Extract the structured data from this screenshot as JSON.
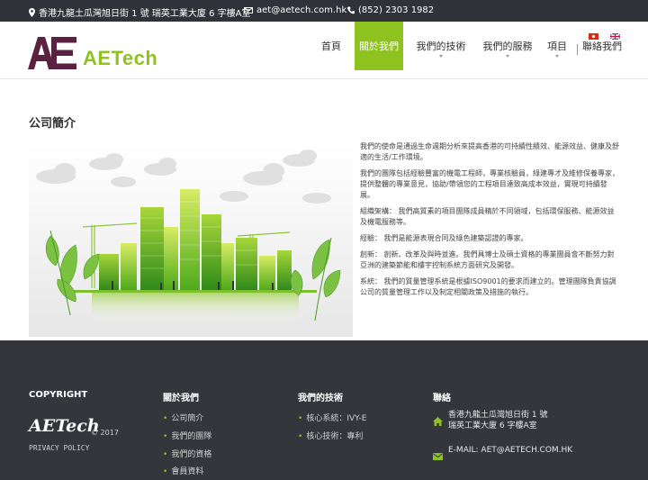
{
  "topbar": {
    "address": "香港九龍土瓜灣旭日街 1 號 瑞英工業大廈 6 字樓A室",
    "email": "aet@aetech.com.hk",
    "phone": "(852) 2303 1982"
  },
  "brand": {
    "logo_letters": "AE",
    "name": "AETech",
    "accent_color": "#8dc21f"
  },
  "nav": {
    "items": [
      "首頁",
      "關於我們",
      "我們的技術",
      "我們的服務",
      "項目",
      "聯絡我們"
    ],
    "active": "關於我們",
    "flags": [
      "hk-flag-icon",
      "uk-flag-icon"
    ]
  },
  "main": {
    "title": "公司簡介",
    "paragraphs": [
      "我們的使命是通過生命週期分析來提高香港的可持續性績效、能源效益、健康及舒適的生活/工作環境。",
      "我們的團隊包括經驗豐富的機電工程師，專業核驗員，綠建專才及維修保養專家，提供整體的專業意見，協助/帶領您的工程項目達致高成本效益，實現可持續發展。",
      "組織架構： 我們高質素的項目團隊成員精於不同領域，包括環保服務、能源效益及機電服務等。",
      "經驗： 我們是能源表現合同及綠色建築認證的專家。",
      "創新： 創新、改革及與時並進。我們具博士及碩士資格的專業團員會不斷努力對亞洲的建築節能和樓宇控制系統方面研究及開發。",
      "系統： 我們的質量管理系統是根據ISO9001的要求而建立的。管理團隊負責協調公司的質量管理工作以及制定相關政策及措施的執行。"
    ]
  },
  "footer": {
    "copyright_heading": "COPYRIGHT",
    "brand": "AETech",
    "year": "© 2017",
    "privacy": "PRIVACY POLICY",
    "col_about": {
      "heading": "關於我們",
      "links": [
        "公司簡介",
        "我們的團隊",
        "我們的資格",
        "會員資料"
      ]
    },
    "col_tech": {
      "heading": "我們的技術",
      "links": [
        "核心系統：IVY-E",
        "核心技術：專利"
      ]
    },
    "col_contact": {
      "heading": "聯絡",
      "address_line1": "香港九龍土瓜灣旭日街 1 號",
      "address_line2": "瑞英工業大廈 6 字樓A室",
      "email": "E-MAIL: AET@AETECH.COM.HK"
    }
  }
}
